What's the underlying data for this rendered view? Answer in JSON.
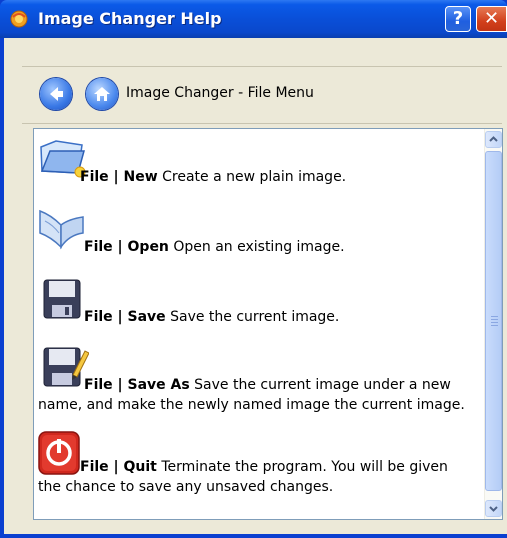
{
  "window": {
    "title": "Image Changer Help"
  },
  "title_buttons": {
    "help": "?",
    "close": "✕"
  },
  "nav": {
    "title": "Image Changer - File Menu"
  },
  "entries": [
    {
      "cmd": "File | New",
      "desc": " Create a new plain image.",
      "icon": "new-image-icon"
    },
    {
      "cmd": "File | Open",
      "desc": " Open an existing image.",
      "icon": "open-book-icon"
    },
    {
      "cmd": "File | Save",
      "desc": " Save the current image.",
      "icon": "floppy-disk-icon"
    },
    {
      "cmd": "File | Save As",
      "desc": " Save the current image under a new name, and make the newly named image the current image.",
      "icon": "floppy-pencil-icon"
    },
    {
      "cmd": "File | Quit",
      "desc": " Terminate the program. You will be given the chance to save any unsaved changes.",
      "icon": "power-icon"
    }
  ],
  "colors": {
    "title_bar": "#0a4fd8",
    "frame": "#0a3fd0",
    "client_bg": "#ece9d8",
    "close_button": "#d2401c"
  }
}
